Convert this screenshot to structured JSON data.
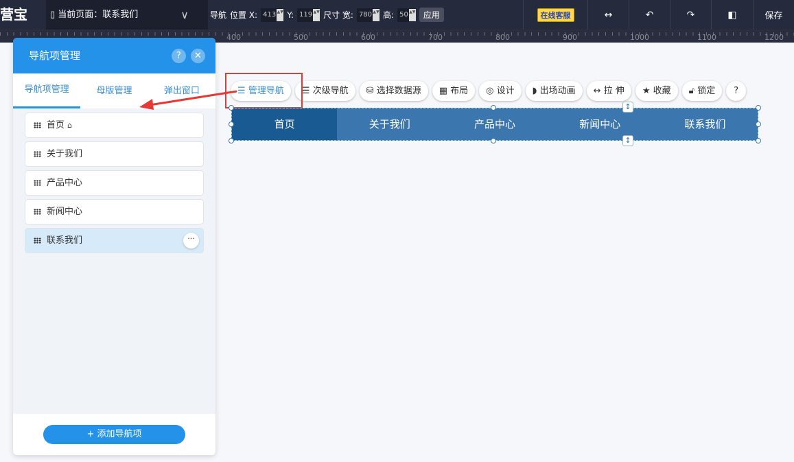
{
  "topbar": {
    "logo": "营宝",
    "current_page": "当前页面：联系我们",
    "element_type": "导航",
    "pos_label": "位置 X:",
    "x": "413",
    "y_label": "Y:",
    "y": "119",
    "size_label": "尺寸 宽:",
    "width": "780",
    "height_label": "高:",
    "height": "50",
    "apply": "应用",
    "support": "在线客服",
    "save": "保存"
  },
  "ruler": {
    "ticks": [
      "400",
      "500",
      "600",
      "700",
      "800",
      "900",
      "1000",
      "1100",
      "1200"
    ]
  },
  "panel": {
    "title": "导航项管理",
    "help": "?",
    "tabs": [
      "导航项管理",
      "母版管理",
      "弹出窗口"
    ],
    "items": [
      "首页",
      "关于我们",
      "产品中心",
      "新闻中心",
      "联系我们"
    ],
    "add_button": "+  添加导航项"
  },
  "toolbar": {
    "items": [
      "管理导航",
      "次级导航",
      "选择数据源",
      "布局",
      "设计",
      "出场动画",
      "拉 伸",
      "收藏",
      "锁定"
    ],
    "help": "?"
  },
  "nav": {
    "items": [
      "首页",
      "关于我们",
      "产品中心",
      "新闻中心",
      "联系我们"
    ]
  }
}
